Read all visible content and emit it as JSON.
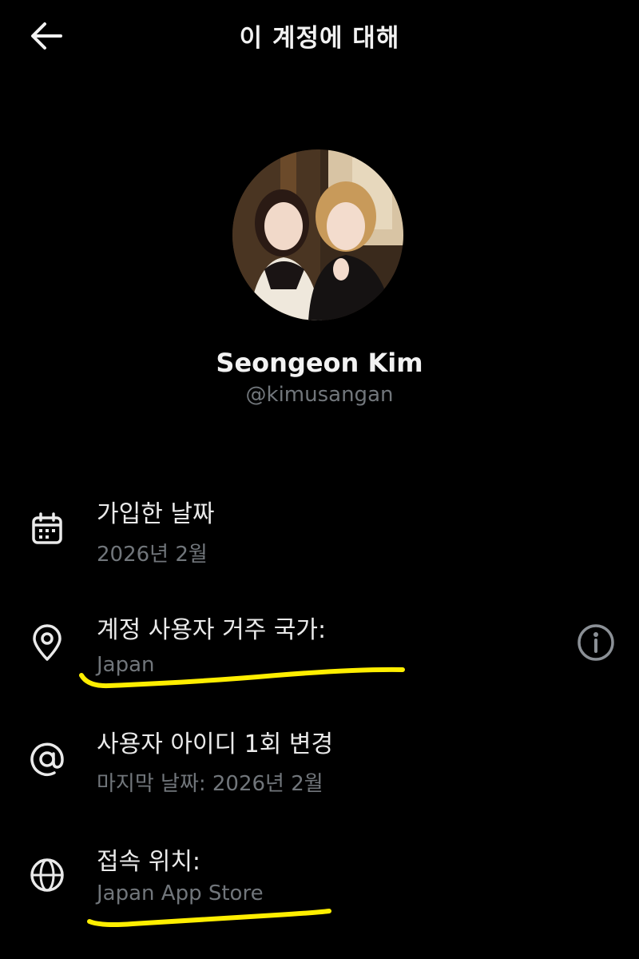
{
  "header": {
    "title": "이 계정에 대해",
    "back_icon": "arrow-left-icon"
  },
  "profile": {
    "display_name": "Seongeon Kim",
    "handle": "@kimusangan",
    "avatar_icon": "profile-photo"
  },
  "rows": [
    {
      "icon": "calendar-icon",
      "title": "가입한 날짜",
      "subtitle": "2026년 2월"
    },
    {
      "icon": "location-pin-icon",
      "title": "계정 사용자 거주 국가:",
      "subtitle": "Japan",
      "action_icon": "info-icon"
    },
    {
      "icon": "at-sign-icon",
      "title": "사용자 아이디 1회 변경",
      "subtitle": "마지막 날짜: 2026년 2월"
    },
    {
      "icon": "globe-icon",
      "title": "접속 위치:",
      "subtitle": "Japan App Store"
    }
  ],
  "colors": {
    "background": "#000000",
    "primary_text": "#e7e9ea",
    "secondary_text": "#71767b",
    "highlight_marker": "#ffee00"
  }
}
